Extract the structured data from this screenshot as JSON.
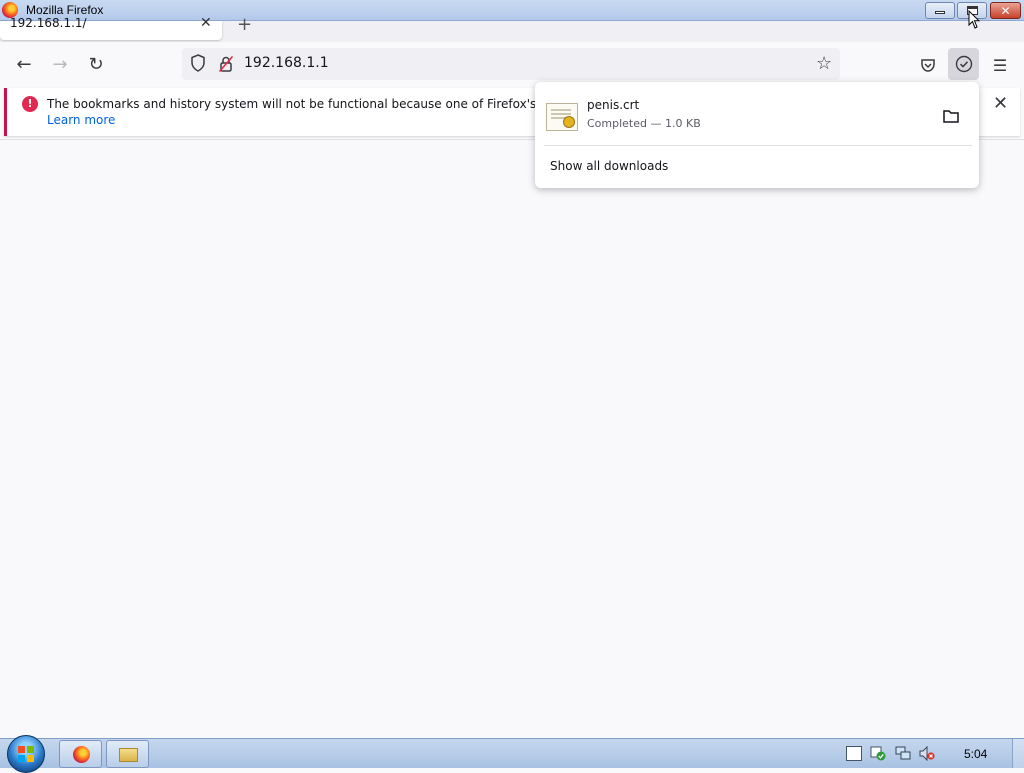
{
  "window": {
    "title": "Mozilla Firefox",
    "close_glyph": "✕"
  },
  "tab": {
    "title": "192.168.1.1/",
    "close_glyph": "✕",
    "new_tab_glyph": "+"
  },
  "navbar": {
    "back_glyph": "←",
    "forward_glyph": "→",
    "reload_glyph": "↻",
    "url": "192.168.1.1",
    "bookmark_glyph": "☆",
    "menu_glyph": "☰"
  },
  "notification": {
    "icon_glyph": "!",
    "message": "The bookmarks and history system will not be functional because one of Firefox's files is in us",
    "link": "Learn more",
    "close_glyph": "✕"
  },
  "downloads": {
    "items": [
      {
        "filename": "penis.crt",
        "status": "Completed — 1.0 KB"
      }
    ],
    "show_all": "Show all downloads"
  },
  "taskbar": {
    "clock": "5:04"
  },
  "colors": {
    "accent_error": "#e22850",
    "link": "#0061e0"
  }
}
